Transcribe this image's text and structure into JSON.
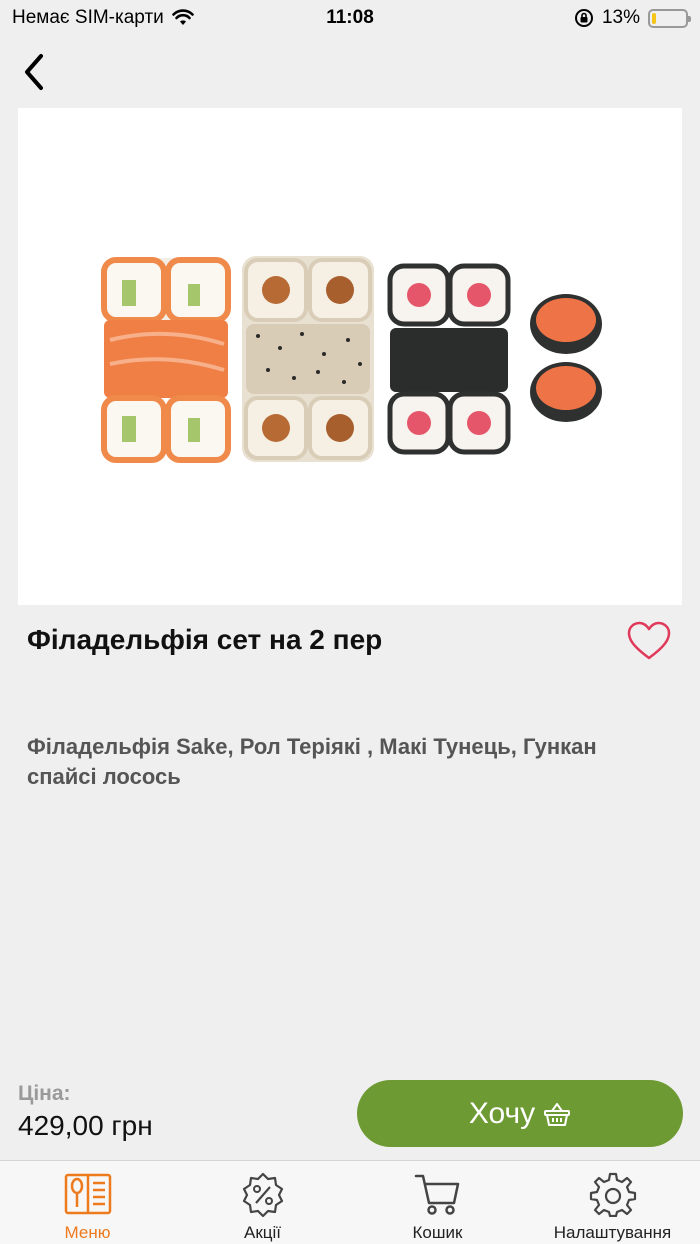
{
  "status_bar": {
    "carrier": "Немає SIM-карти",
    "time": "11:08",
    "battery": "13%",
    "battery_level": 0.13
  },
  "product": {
    "title": "Філадельфія сет на 2 пер",
    "description": "Філадельфія Sake, Рол Теріякі , Макі Тунець, Гункан спайсі лосось",
    "price_label": "Ціна:",
    "price": "429,00 грн",
    "image_icon": "sushi-set-image"
  },
  "actions": {
    "want_label": "Хочу",
    "want_color": "#6e9a34"
  },
  "tabs": [
    {
      "label": "Меню",
      "icon": "menu-book-icon",
      "active": true
    },
    {
      "label": "Акції",
      "icon": "discount-badge-icon",
      "active": false
    },
    {
      "label": "Кошик",
      "icon": "cart-icon",
      "active": false
    },
    {
      "label": "Налаштування",
      "icon": "gear-icon",
      "active": false
    }
  ],
  "colors": {
    "accent": "#ee7a1e",
    "heart": "#e0395a",
    "background": "#efefef"
  }
}
